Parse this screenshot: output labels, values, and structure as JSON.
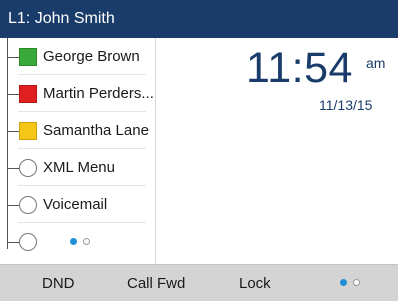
{
  "title": "L1: John Smith",
  "line_keys": [
    {
      "label": "George Brown",
      "status": "available",
      "color": "#3aa83a"
    },
    {
      "label": "Martin Perders...",
      "status": "busy",
      "color": "#e02020"
    },
    {
      "label": "Samantha Lane",
      "status": "away",
      "color": "#f5c518"
    },
    {
      "label": "XML Menu",
      "status": "none"
    },
    {
      "label": "Voicemail",
      "status": "none"
    }
  ],
  "key_pagination": {
    "current": 1,
    "total": 2
  },
  "clock": {
    "time": "11:54",
    "ampm": "am",
    "date": "11/13/15"
  },
  "softkeys": {
    "dnd": "DND",
    "call_fwd": "Call Fwd",
    "lock": "Lock",
    "pagination": {
      "current": 1,
      "total": 2
    }
  },
  "colors": {
    "header_bg": "#1a3c6a",
    "accent": "#1f8fd6",
    "softkey_bg": "#d4d4d4"
  }
}
